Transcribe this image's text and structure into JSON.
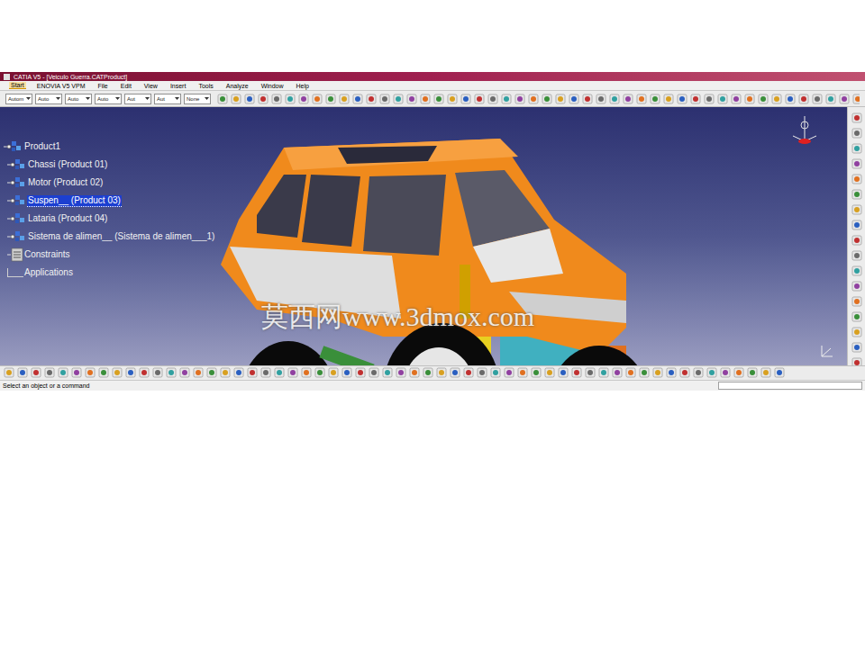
{
  "window": {
    "title": "CATIA V5 - [Veiculo Guerra.CATProduct]"
  },
  "menu": [
    {
      "label": "Start",
      "selected": true
    },
    {
      "label": "ENOVIA V5 VPM",
      "selected": false
    },
    {
      "label": "File",
      "selected": false
    },
    {
      "label": "Edit",
      "selected": false
    },
    {
      "label": "View",
      "selected": false
    },
    {
      "label": "Insert",
      "selected": false
    },
    {
      "label": "Tools",
      "selected": false
    },
    {
      "label": "Analyze",
      "selected": false
    },
    {
      "label": "Window",
      "selected": false
    },
    {
      "label": "Help",
      "selected": false
    }
  ],
  "toolbar_dropdowns": [
    "Autom",
    "Auto",
    "Auto",
    "Auto",
    "Aut",
    "Aut",
    "None"
  ],
  "tree": [
    {
      "label": "Product1",
      "kind": "root",
      "selected": false
    },
    {
      "label": "Chassi (Product 01)",
      "kind": "product",
      "selected": false
    },
    {
      "label": "Motor (Product 02)",
      "kind": "product",
      "selected": false
    },
    {
      "label": "Suspen__ (Product 03)",
      "kind": "product",
      "selected": true
    },
    {
      "label": "Lataria (Product 04)",
      "kind": "product",
      "selected": false
    },
    {
      "label": "Sistema de alimen__ (Sistema de alimen___1)",
      "kind": "product",
      "selected": false
    },
    {
      "label": "Constraints",
      "kind": "constraints",
      "selected": false
    },
    {
      "label": "Applications",
      "kind": "applications",
      "selected": false
    }
  ],
  "watermark": "莫西网www.3dmox.com",
  "status_bar": "Select an object or a command"
}
